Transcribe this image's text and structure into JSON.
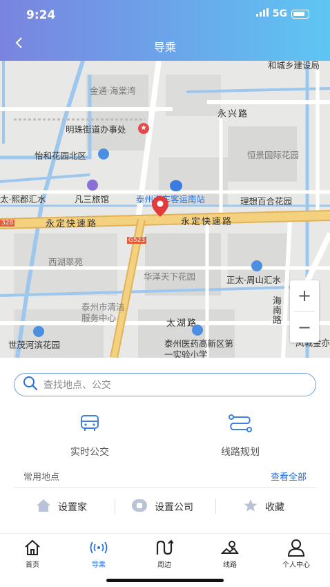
{
  "status_bar": {
    "time": "9:24",
    "network": "5G"
  },
  "header": {
    "title": "导乘"
  },
  "map": {
    "labels": {
      "jinhuaxiang": "和城乡建设局",
      "jintong": "金通·海棠湾",
      "yongxing_road": "永兴路",
      "mingzhu": "明珠街道办事处",
      "yihe": "怡和花园北区",
      "hengjing": "恒景国际花园",
      "junhuishui": "太·熙郡汇水",
      "fansan": "凡三旅馆",
      "taizhou_station": "泰州汽车客运南站",
      "lixiang": "理想百合花园",
      "yongding_left": "永定快速路",
      "yongding_right": "永定快速路",
      "s328": "328",
      "g523": "G523",
      "xihu": "西湖翠苑",
      "huaze": "华泽天下花园",
      "zhengtai": "正太·周山汇水",
      "taizhou_clean": "泰州市清洁服务中心",
      "taihu_road": "太湖路",
      "hainan_road": "海南路",
      "shimao": "世茂河滨花园",
      "yiyao": "泰州医药高新区第一实验小学",
      "fengcheng": "凤城金亦"
    },
    "zoom_in": "+",
    "zoom_out": "−"
  },
  "search": {
    "placeholder": "查找地点、公交"
  },
  "features": [
    {
      "label": "实时公交",
      "icon": "bus-icon"
    },
    {
      "label": "线路规划",
      "icon": "route-icon"
    }
  ],
  "common_places": {
    "title": "常用地点",
    "view_all": "查看全部",
    "items": [
      {
        "label": "设置家",
        "icon": "home-icon"
      },
      {
        "label": "设置公司",
        "icon": "briefcase-icon"
      },
      {
        "label": "收藏",
        "icon": "star-icon"
      }
    ]
  },
  "tabs": [
    {
      "label": "首页",
      "icon": "home-tab-icon"
    },
    {
      "label": "导乘",
      "icon": "broadcast-icon"
    },
    {
      "label": "周边",
      "icon": "nearby-icon"
    },
    {
      "label": "线路",
      "icon": "route-map-icon"
    },
    {
      "label": "个人中心",
      "icon": "user-icon"
    }
  ],
  "colors": {
    "accent": "#2a6fdb",
    "header_start": "#7a84e0",
    "header_end": "#5ec6f3"
  }
}
